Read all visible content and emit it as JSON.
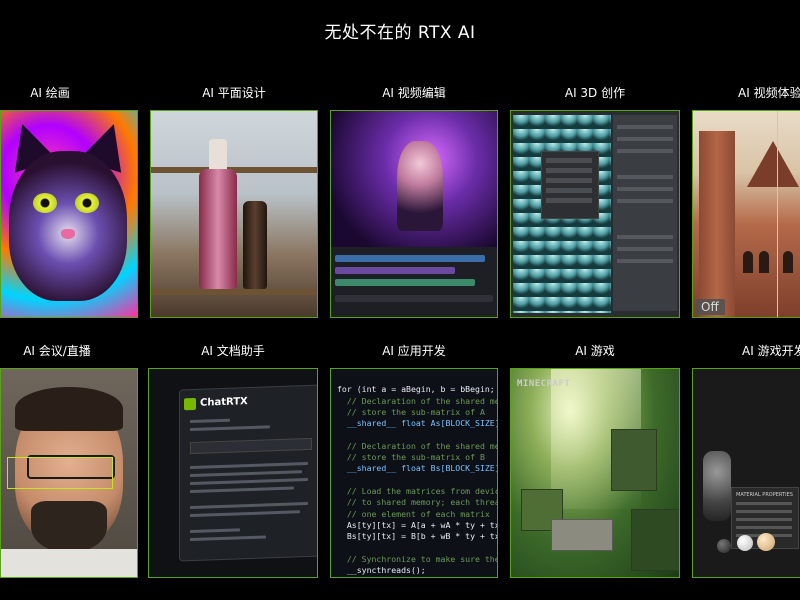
{
  "page": {
    "title": "无处不在的 RTX AI"
  },
  "row1": [
    {
      "label": "AI 绘画"
    },
    {
      "label": "AI 平面设计"
    },
    {
      "label": "AI 视频编辑"
    },
    {
      "label": "AI 3D 创作"
    },
    {
      "label": "AI 视频体验"
    }
  ],
  "row2": [
    {
      "label": "AI 会议/直播"
    },
    {
      "label": "AI 文档助手"
    },
    {
      "label": "AI 应用开发"
    },
    {
      "label": "AI 游戏"
    },
    {
      "label": "AI 游戏开发"
    }
  ],
  "video_experience": {
    "off_badge": "Off"
  },
  "chatrtx": {
    "title": "ChatRTX"
  },
  "minecraft": {
    "logo": "MINECRAFT"
  },
  "game_dev": {
    "panel_title": "MATERIAL PROPERTIES"
  },
  "code": {
    "lines": [
      "for (int a = aBegin, b = bBegin; a <",
      "  // Declaration of the shared memor",
      "  // store the sub-matrix of A",
      "  __shared__ float As[BLOCK_SIZE][BL",
      "",
      "  // Declaration of the shared memor",
      "  // store the sub-matrix of B",
      "  __shared__ float Bs[BLOCK_SIZE][BL",
      "",
      "  // Load the matrices from device m",
      "  // to shared memory; each thread l",
      "  // one element of each matrix",
      "  As[ty][tx] = A[a + wA * ty + tx];",
      "  Bs[ty][tx] = B[b + wB * ty + tx];",
      "",
      "  // Synchronize to make sure the ma",
      "  __syncthreads();"
    ]
  },
  "colors": {
    "tile_border": "#5aa317",
    "background": "#000000",
    "nvidia_green": "#76b900"
  }
}
